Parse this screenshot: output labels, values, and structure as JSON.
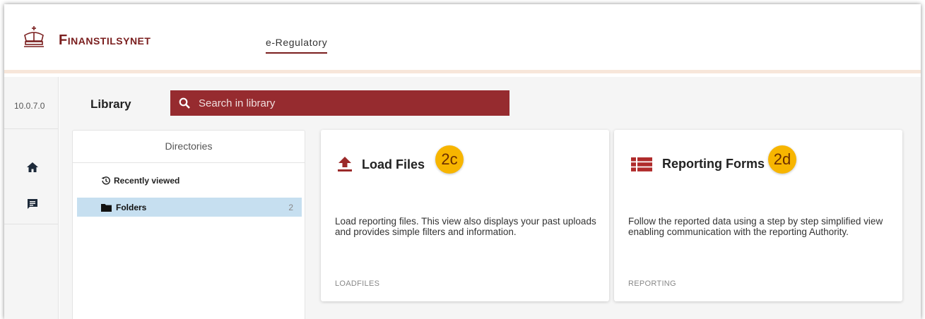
{
  "header": {
    "brand": "Finanstilsynet",
    "tab": "e-Regulatory"
  },
  "rail": {
    "version": "10.0.7.0",
    "icons": [
      "home-icon",
      "chat-icon"
    ]
  },
  "library": {
    "title": "Library",
    "search_placeholder": "Search in library"
  },
  "directories": {
    "title": "Directories",
    "recent": "Recently viewed",
    "folders": {
      "label": "Folders",
      "count": "2"
    }
  },
  "cards": [
    {
      "title": "Load Files",
      "badge": "2c",
      "description": "Load reporting files. This view also displays your past uploads and provides simple filters and information.",
      "footer": "LOADFILES"
    },
    {
      "title": "Reporting Forms",
      "badge": "2d",
      "description": "Follow the reported data using a step by step simplified view enabling communication with the reporting Authority.",
      "footer": "REPORTING"
    }
  ],
  "colors": {
    "brand": "#7a1e1e",
    "search_bg": "#962b2f",
    "badge": "#f7b500",
    "folder_selected": "#c6dff0"
  }
}
